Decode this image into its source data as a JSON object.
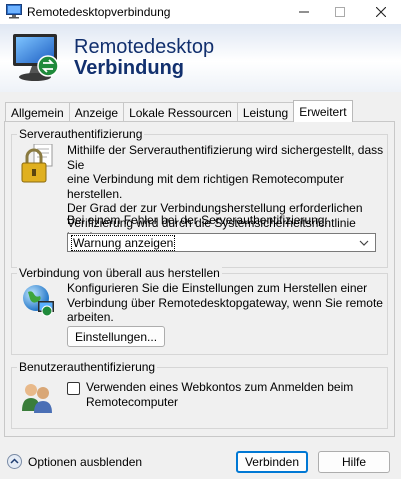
{
  "window": {
    "title": "Remotedesktopverbindung",
    "app_icon": "remote-desktop-icon",
    "controls": {
      "minimize": "minimize-icon",
      "maximize": "maximize-icon",
      "close": "close-icon"
    }
  },
  "banner": {
    "line1": "Remotedesktop",
    "line2": "Verbindung",
    "icon": "remote-desktop-monitor-icon",
    "title_color": "#12306e"
  },
  "tabs": [
    {
      "label": "Allgemein",
      "active": false
    },
    {
      "label": "Anzeige",
      "active": false
    },
    {
      "label": "Lokale Ressourcen",
      "active": false
    },
    {
      "label": "Leistung",
      "active": false
    },
    {
      "label": "Erweitert",
      "active": true
    }
  ],
  "server_auth": {
    "title": "Serverauthentifizierung",
    "icon": "padlock-certificate-icon",
    "description": [
      "Mithilfe der Serverauthentifizierung wird sichergestellt, dass Sie",
      "eine Verbindung mit dem richtigen Remotecomputer herstellen.",
      "Der Grad der zur Verbindungsherstellung erforderlichen",
      "Verifizierung wird durch die Systemsicherheitsrichtlinie bestimmt."
    ],
    "error_label": "Bei einem Fehler bei der Serverauthentifizierung:",
    "selected_option": "Warnung anzeigen"
  },
  "connect_anywhere": {
    "title": "Verbindung von überall aus herstellen",
    "icon": "globe-network-icon",
    "description": [
      "Konfigurieren Sie die Einstellungen zum Herstellen einer",
      "Verbindung über Remotedesktopgateway, wenn Sie remote",
      "arbeiten."
    ],
    "settings_button": "Einstellungen..."
  },
  "user_auth": {
    "title": "Benutzerauthentifizierung",
    "icon": "users-icon",
    "checkbox_checked": false,
    "checkbox_label": [
      "Verwenden eines Webkontos zum Anmelden beim",
      "Remotecomputer"
    ]
  },
  "footer": {
    "options_toggle": "Optionen ausblenden",
    "options_icon": "chevron-up-circle-icon",
    "connect_button": "Verbinden",
    "help_button": "Hilfe",
    "accent_color": "#0078d4"
  }
}
